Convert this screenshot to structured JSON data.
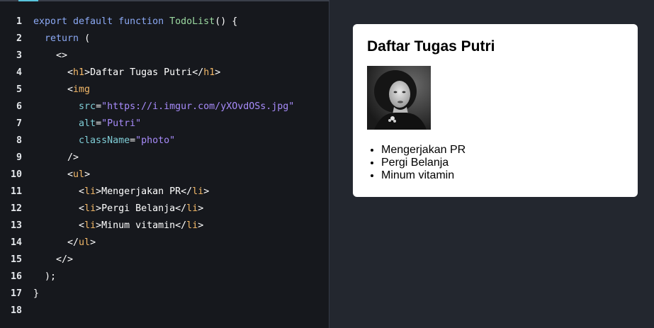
{
  "editor": {
    "lines": [
      {
        "n": "1",
        "segs": [
          [
            "kw",
            "export default function "
          ],
          [
            "fn",
            "TodoList"
          ],
          [
            "pn",
            "() {"
          ]
        ]
      },
      {
        "n": "2",
        "segs": [
          [
            "pn",
            "  "
          ],
          [
            "kw",
            "return"
          ],
          [
            "pn",
            " ("
          ]
        ]
      },
      {
        "n": "3",
        "segs": [
          [
            "pn",
            "    <>"
          ]
        ]
      },
      {
        "n": "4",
        "segs": [
          [
            "pn",
            "      <"
          ],
          [
            "tg",
            "h1"
          ],
          [
            "pn",
            ">"
          ],
          [
            "tx",
            "Daftar Tugas Putri"
          ],
          [
            "pn",
            "</"
          ],
          [
            "tg",
            "h1"
          ],
          [
            "pn",
            ">"
          ]
        ]
      },
      {
        "n": "5",
        "segs": [
          [
            "pn",
            "      <"
          ],
          [
            "tg",
            "img"
          ]
        ]
      },
      {
        "n": "6",
        "segs": [
          [
            "at",
            "        src"
          ],
          [
            "pn",
            "="
          ],
          [
            "st",
            "\"https://i.imgur.com/yXOvdOSs.jpg\""
          ]
        ]
      },
      {
        "n": "7",
        "segs": [
          [
            "at",
            "        alt"
          ],
          [
            "pn",
            "="
          ],
          [
            "st",
            "\"Putri\""
          ]
        ]
      },
      {
        "n": "8",
        "segs": [
          [
            "at",
            "        className"
          ],
          [
            "pn",
            "="
          ],
          [
            "st",
            "\"photo\""
          ]
        ]
      },
      {
        "n": "9",
        "segs": [
          [
            "pn",
            "      />"
          ]
        ]
      },
      {
        "n": "10",
        "segs": [
          [
            "pn",
            "      <"
          ],
          [
            "tg",
            "ul"
          ],
          [
            "pn",
            ">"
          ]
        ]
      },
      {
        "n": "11",
        "segs": [
          [
            "pn",
            "        <"
          ],
          [
            "tg",
            "li"
          ],
          [
            "pn",
            ">"
          ],
          [
            "tx",
            "Mengerjakan PR"
          ],
          [
            "pn",
            "</"
          ],
          [
            "tg",
            "li"
          ],
          [
            "pn",
            ">"
          ]
        ]
      },
      {
        "n": "12",
        "segs": [
          [
            "pn",
            "        <"
          ],
          [
            "tg",
            "li"
          ],
          [
            "pn",
            ">"
          ],
          [
            "tx",
            "Pergi Belanja"
          ],
          [
            "pn",
            "</"
          ],
          [
            "tg",
            "li"
          ],
          [
            "pn",
            ">"
          ]
        ]
      },
      {
        "n": "13",
        "segs": [
          [
            "pn",
            "        <"
          ],
          [
            "tg",
            "li"
          ],
          [
            "pn",
            ">"
          ],
          [
            "tx",
            "Minum vitamin"
          ],
          [
            "pn",
            "</"
          ],
          [
            "tg",
            "li"
          ],
          [
            "pn",
            ">"
          ]
        ]
      },
      {
        "n": "14",
        "segs": [
          [
            "pn",
            "      </"
          ],
          [
            "tg",
            "ul"
          ],
          [
            "pn",
            ">"
          ]
        ]
      },
      {
        "n": "15",
        "segs": [
          [
            "pn",
            "    </>"
          ]
        ]
      },
      {
        "n": "16",
        "segs": [
          [
            "pn",
            "  );"
          ]
        ]
      },
      {
        "n": "17",
        "segs": [
          [
            "pn",
            "}"
          ]
        ]
      },
      {
        "n": "18",
        "segs": []
      }
    ]
  },
  "preview": {
    "title": "Daftar Tugas Putri",
    "photo_alt": "Putri",
    "items": [
      "Mengerjakan PR",
      "Pergi Belanja",
      "Minum vitamin"
    ]
  },
  "colors": {
    "keyword": "#8ba8f3",
    "function": "#9bd8a0",
    "tag": "#f2b868",
    "attribute": "#7fcdd6",
    "string": "#a78bfa",
    "editor_bg": "#16181d",
    "preview_bg": "#23272f",
    "accent": "#58c4dc"
  }
}
